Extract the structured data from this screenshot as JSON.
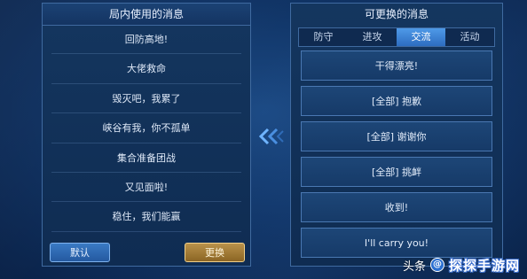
{
  "left_panel": {
    "title": "局内使用的消息",
    "messages": [
      "回防高地!",
      "大佬救命",
      "毁灭吧，我累了",
      "峡谷有我，你不孤单",
      "集合准备团战",
      "又见面啦!",
      "稳住，我们能赢"
    ],
    "default_button": "默认",
    "replace_button": "更换"
  },
  "right_panel": {
    "title": "可更换的消息",
    "tabs": [
      "防守",
      "进攻",
      "交流",
      "活动"
    ],
    "active_tab": "交流",
    "options": [
      "干得漂亮!",
      "[全部] 抱歉",
      "[全部] 谢谢你",
      "[全部] 挑衅",
      "收到!",
      "I'll carry you!"
    ]
  },
  "watermark": {
    "source": "头条",
    "badge": "@",
    "site": "探探手游网"
  },
  "colors": {
    "panel_border": "#3f6aa0",
    "active_tab": "#4f9ae8",
    "default_button": "#2459a0",
    "replace_button": "#b9924a"
  }
}
